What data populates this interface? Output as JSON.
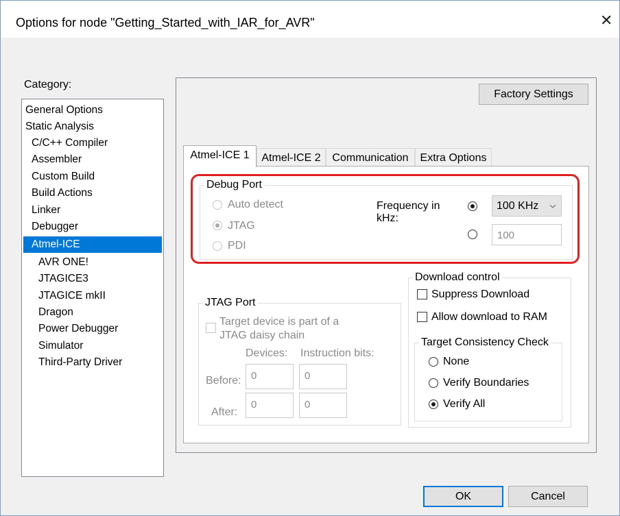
{
  "window": {
    "title": "Options for node \"Getting_Started_with_IAR_for_AVR\"",
    "close_glyph": "✕"
  },
  "category": {
    "label": "Category:",
    "items": [
      {
        "label": "General Options"
      },
      {
        "label": "Static Analysis"
      },
      {
        "label": "C/C++ Compiler"
      },
      {
        "label": "Assembler"
      },
      {
        "label": "Custom Build"
      },
      {
        "label": "Build Actions"
      },
      {
        "label": "Linker"
      },
      {
        "label": "Debugger"
      },
      {
        "label": "Atmel-ICE",
        "selected": true
      },
      {
        "label": "AVR ONE!"
      },
      {
        "label": "JTAGICE3"
      },
      {
        "label": "JTAGICE mkII"
      },
      {
        "label": "Dragon"
      },
      {
        "label": "Power Debugger"
      },
      {
        "label": "Simulator"
      },
      {
        "label": "Third-Party Driver"
      }
    ]
  },
  "factory_settings_label": "Factory Settings",
  "tabs": [
    {
      "label": "Atmel-ICE 1",
      "active": true
    },
    {
      "label": "Atmel-ICE 2",
      "active": false
    },
    {
      "label": "Communication",
      "active": false
    },
    {
      "label": "Extra Options",
      "active": false
    }
  ],
  "debug_port": {
    "legend": "Debug Port",
    "auto_detect": "Auto detect",
    "jtag": "JTAG",
    "pdi": "PDI",
    "selected": "JTAG",
    "frequency_label_line1": "Frequency in",
    "frequency_label_line2": "kHz:",
    "frequency_combo_value": "100 KHz",
    "frequency_custom_value": "100",
    "frequency_mode": "combo"
  },
  "jtag_port": {
    "legend": "JTAG Port",
    "daisy_line1": "Target device is part of a",
    "daisy_line2": "JTAG daisy chain",
    "devices_header": "Devices:",
    "instruction_bits_header": "Instruction bits:",
    "before_label": "Before:",
    "after_label": "After:",
    "before_devices": "0",
    "before_instruction_bits": "0",
    "after_devices": "0",
    "after_instruction_bits": "0"
  },
  "download_control": {
    "legend": "Download control",
    "suppress_download": "Suppress Download",
    "allow_download_ram": "Allow download to RAM",
    "suppress_checked": false,
    "allow_ram_checked": false
  },
  "consistency": {
    "legend": "Target Consistency Check",
    "none": "None",
    "verify_boundaries": "Verify Boundaries",
    "verify_all": "Verify All",
    "selected": "Verify All"
  },
  "buttons": {
    "ok": "OK",
    "cancel": "Cancel"
  },
  "colors": {
    "selection": "#0078d7",
    "highlight_outline": "#e02020"
  }
}
